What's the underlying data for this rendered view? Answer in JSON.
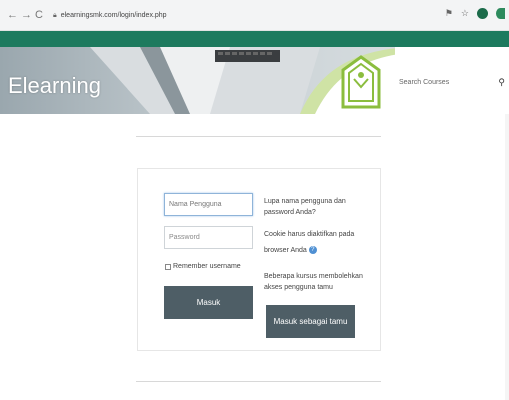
{
  "browser": {
    "back": "←",
    "forward": "→",
    "reload": "C",
    "url": "elearningsmk.com/login/index.php",
    "icons": [
      "translate-icon",
      "star-icon",
      "extension-icon",
      "profile-icon"
    ]
  },
  "header": {
    "site_title": "Elearning",
    "search_placeholder": "Search Courses",
    "accent_color": "#1d7a5e"
  },
  "login": {
    "username_placeholder": "Nama Pengguna",
    "password_placeholder": "Password",
    "remember_label": "Remember username",
    "login_button": "Masuk",
    "forgot_line1": "Lupa nama pengguna dan",
    "forgot_line2": "password Anda?",
    "cookie_line1": "Cookie harus diaktifkan pada",
    "cookie_line2": "browser Anda",
    "guest_line1": "Beberapa kursus membolehkan",
    "guest_line2": "akses pengguna tamu",
    "guest_button": "Masuk sebagai tamu",
    "button_color": "#4e5e66"
  }
}
